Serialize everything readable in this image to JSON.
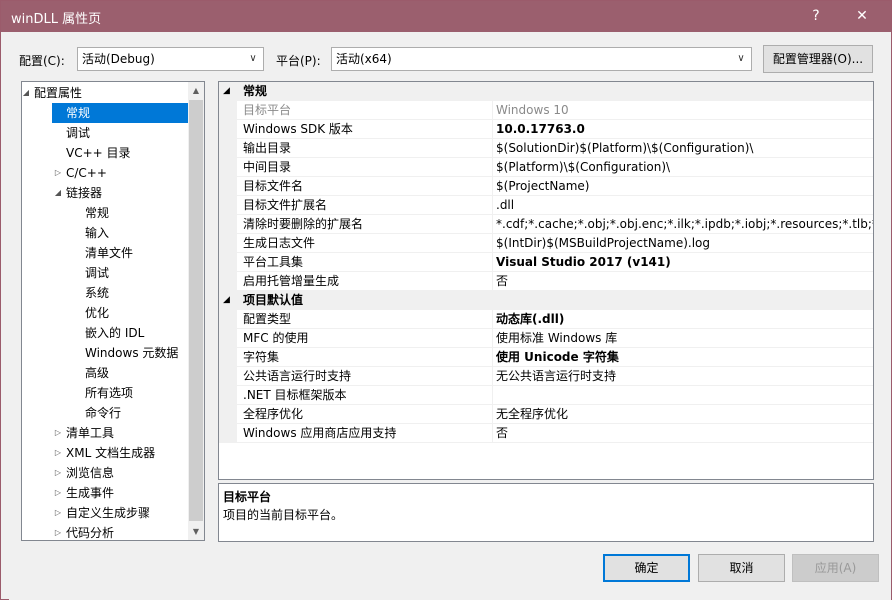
{
  "window": {
    "title": "winDLL 属性页",
    "help_glyph": "?",
    "close_glyph": "✕"
  },
  "config": {
    "config_label": "配置(C):",
    "config_value": "活动(Debug)",
    "platform_label": "平台(P):",
    "platform_value": "活动(x64)",
    "manager_button": "配置管理器(O)..."
  },
  "tree": {
    "items": [
      {
        "label": "配置属性",
        "level": 0,
        "arrow": "◢",
        "selected": false
      },
      {
        "label": "常规",
        "level": 1,
        "arrow": "",
        "selected": true
      },
      {
        "label": "调试",
        "level": 1,
        "arrow": "",
        "selected": false
      },
      {
        "label": "VC++ 目录",
        "level": 1,
        "arrow": "",
        "selected": false
      },
      {
        "label": "C/C++",
        "level": 1,
        "arrow": "▷",
        "selected": false
      },
      {
        "label": "链接器",
        "level": 1,
        "arrow": "◢",
        "selected": false
      },
      {
        "label": "常规",
        "level": 2,
        "arrow": "",
        "selected": false
      },
      {
        "label": "输入",
        "level": 2,
        "arrow": "",
        "selected": false
      },
      {
        "label": "清单文件",
        "level": 2,
        "arrow": "",
        "selected": false
      },
      {
        "label": "调试",
        "level": 2,
        "arrow": "",
        "selected": false
      },
      {
        "label": "系统",
        "level": 2,
        "arrow": "",
        "selected": false
      },
      {
        "label": "优化",
        "level": 2,
        "arrow": "",
        "selected": false
      },
      {
        "label": "嵌入的 IDL",
        "level": 2,
        "arrow": "",
        "selected": false
      },
      {
        "label": "Windows 元数据",
        "level": 2,
        "arrow": "",
        "selected": false
      },
      {
        "label": "高级",
        "level": 2,
        "arrow": "",
        "selected": false
      },
      {
        "label": "所有选项",
        "level": 2,
        "arrow": "",
        "selected": false
      },
      {
        "label": "命令行",
        "level": 2,
        "arrow": "",
        "selected": false
      },
      {
        "label": "清单工具",
        "level": 1,
        "arrow": "▷",
        "selected": false
      },
      {
        "label": "XML 文档生成器",
        "level": 1,
        "arrow": "▷",
        "selected": false
      },
      {
        "label": "浏览信息",
        "level": 1,
        "arrow": "▷",
        "selected": false
      },
      {
        "label": "生成事件",
        "level": 1,
        "arrow": "▷",
        "selected": false
      },
      {
        "label": "自定义生成步骤",
        "level": 1,
        "arrow": "▷",
        "selected": false
      },
      {
        "label": "代码分析",
        "level": 1,
        "arrow": "▷",
        "selected": false
      }
    ],
    "scroll_up": "▲",
    "scroll_down": "▼"
  },
  "grid": {
    "sections": [
      {
        "name": "常规",
        "rows": [
          {
            "name": "目标平台",
            "value": "Windows 10",
            "bold": false,
            "dim": true
          },
          {
            "name": "Windows SDK 版本",
            "value": "10.0.17763.0",
            "bold": true,
            "dim": false
          },
          {
            "name": "输出目录",
            "value": "$(SolutionDir)$(Platform)\\$(Configuration)\\",
            "bold": false,
            "dim": false
          },
          {
            "name": "中间目录",
            "value": "$(Platform)\\$(Configuration)\\",
            "bold": false,
            "dim": false
          },
          {
            "name": "目标文件名",
            "value": "$(ProjectName)",
            "bold": false,
            "dim": false
          },
          {
            "name": "目标文件扩展名",
            "value": ".dll",
            "bold": false,
            "dim": false
          },
          {
            "name": "清除时要删除的扩展名",
            "value": "*.cdf;*.cache;*.obj;*.obj.enc;*.ilk;*.ipdb;*.iobj;*.resources;*.tlb;*.tli;*.t",
            "bold": false,
            "dim": false
          },
          {
            "name": "生成日志文件",
            "value": "$(IntDir)$(MSBuildProjectName).log",
            "bold": false,
            "dim": false
          },
          {
            "name": "平台工具集",
            "value": "Visual Studio 2017 (v141)",
            "bold": true,
            "dim": false
          },
          {
            "name": "启用托管增量生成",
            "value": "否",
            "bold": false,
            "dim": false
          }
        ]
      },
      {
        "name": "项目默认值",
        "rows": [
          {
            "name": "配置类型",
            "value": "动态库(.dll)",
            "bold": true,
            "dim": false
          },
          {
            "name": "MFC 的使用",
            "value": "使用标准 Windows 库",
            "bold": false,
            "dim": false
          },
          {
            "name": "字符集",
            "value": "使用 Unicode 字符集",
            "bold": true,
            "dim": false
          },
          {
            "name": "公共语言运行时支持",
            "value": "无公共语言运行时支持",
            "bold": false,
            "dim": false
          },
          {
            "name": ".NET 目标框架版本",
            "value": "",
            "bold": false,
            "dim": false
          },
          {
            "name": "全程序优化",
            "value": "无全程序优化",
            "bold": false,
            "dim": false
          },
          {
            "name": "Windows 应用商店应用支持",
            "value": "否",
            "bold": false,
            "dim": false
          }
        ]
      }
    ]
  },
  "description": {
    "title": "目标平台",
    "text": "项目的当前目标平台。"
  },
  "buttons": {
    "ok": "确定",
    "cancel": "取消",
    "apply": "应用(A)"
  },
  "colors": {
    "titlebar": "#9b5f6e",
    "selection": "#0078d7"
  }
}
